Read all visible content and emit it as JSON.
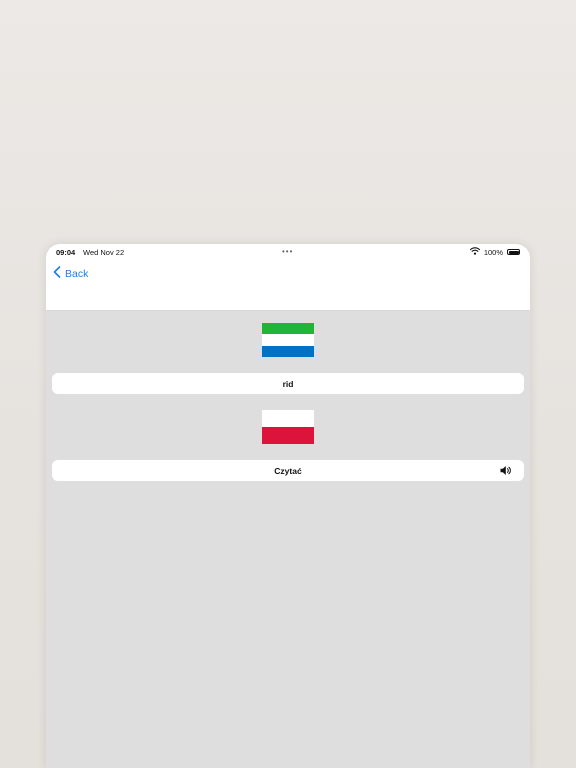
{
  "status_bar": {
    "time": "09:04",
    "date": "Wed Nov 22",
    "multitask_dots": "•••",
    "battery_percent": "100%",
    "icons": [
      "wifi-icon",
      "battery-icon"
    ]
  },
  "nav": {
    "back_label": "Back",
    "icon": "chevron-left-icon",
    "accent_color": "#1e7cf0"
  },
  "source": {
    "flag_name": "Sierra Leone",
    "flag_colors": [
      "#1eb53a",
      "#ffffff",
      "#0072c6"
    ],
    "word": "rid"
  },
  "target": {
    "flag_name": "Poland",
    "flag_colors": [
      "#ffffff",
      "#dc143c"
    ],
    "word": "Czytać",
    "audio_icon": "speaker-icon"
  }
}
